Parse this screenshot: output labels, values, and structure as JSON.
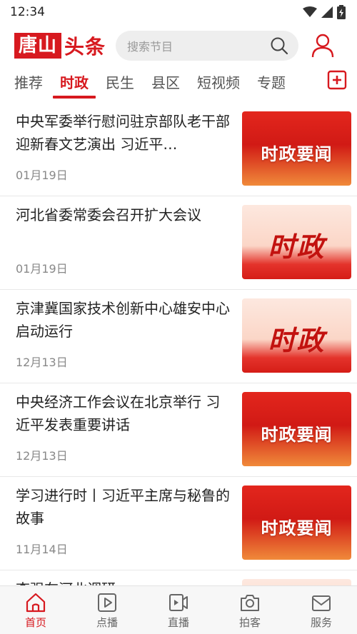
{
  "status": {
    "time": "12:34"
  },
  "header": {
    "logo_box": "唐山",
    "logo_text": "头条",
    "search_placeholder": "搜索节目"
  },
  "tabs": [
    {
      "label": "推荐",
      "active": false
    },
    {
      "label": "时政",
      "active": true
    },
    {
      "label": "民生",
      "active": false
    },
    {
      "label": "县区",
      "active": false
    },
    {
      "label": "短视频",
      "active": false
    },
    {
      "label": "专题",
      "active": false
    }
  ],
  "news": [
    {
      "title": "中央军委举行慰问驻京部队老干部迎新春文艺演出 习近平…",
      "date": "01月19日",
      "thumb_text": "时政要闻",
      "thumb_style": "red"
    },
    {
      "title": "河北省委常委会召开扩大会议",
      "date": "01月19日",
      "thumb_text": "时政",
      "thumb_style": "light"
    },
    {
      "title": "京津冀国家技术创新中心雄安中心启动运行",
      "date": "12月13日",
      "thumb_text": "时政",
      "thumb_style": "light"
    },
    {
      "title": "中央经济工作会议在北京举行 习近平发表重要讲话",
      "date": "12月13日",
      "thumb_text": "时政要闻",
      "thumb_style": "red"
    },
    {
      "title": "学习进行时丨习近平主席与秘鲁的故事",
      "date": "11月14日",
      "thumb_text": "时政要闻",
      "thumb_style": "red"
    },
    {
      "title": "李强在河北调研",
      "date": "",
      "thumb_text": "",
      "thumb_style": "light"
    }
  ],
  "bottom_nav": [
    {
      "label": "首页",
      "icon": "home-icon",
      "active": true
    },
    {
      "label": "点播",
      "icon": "play-icon",
      "active": false
    },
    {
      "label": "直播",
      "icon": "live-camera-icon",
      "active": false
    },
    {
      "label": "拍客",
      "icon": "camera-icon",
      "active": false
    },
    {
      "label": "服务",
      "icon": "mail-icon",
      "active": false
    }
  ],
  "colors": {
    "brand_red": "#d7191f",
    "inactive_gray": "#666666"
  }
}
